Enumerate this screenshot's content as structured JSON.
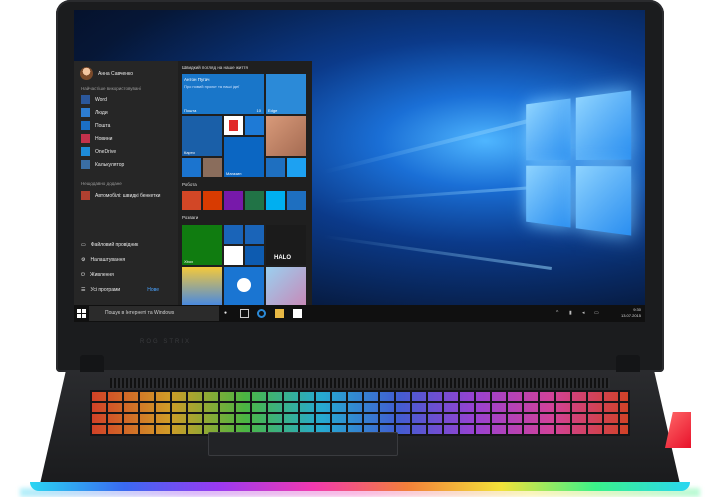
{
  "device": {
    "brand_text": "ROG STRIX"
  },
  "start_menu": {
    "user_name": "Анна Савченко",
    "most_used_header": "Найчастіше використовувані",
    "apps": [
      {
        "label": "Word",
        "color": "#2b579a"
      },
      {
        "label": "Люди",
        "color": "#2d7dd2"
      },
      {
        "label": "Пошта",
        "color": "#1b6fc4"
      },
      {
        "label": "Новини",
        "color": "#c4314b"
      },
      {
        "label": "OneDrive",
        "color": "#1e8bd8"
      },
      {
        "label": "Калькулятор",
        "color": "#3a6ea5"
      }
    ],
    "recently_added_header": "Нещодавно додане",
    "recent_item": "Автомобілі: швидкі бенкетки",
    "bottom_items": [
      {
        "label": "Файловий провідник",
        "icon": "folder-icon"
      },
      {
        "label": "Налаштування",
        "icon": "gear-icon"
      },
      {
        "label": "Живлення",
        "icon": "power-icon"
      },
      {
        "label": "Усі програми",
        "icon": "all-apps-icon",
        "badge": "Нове"
      }
    ],
    "life_header": "Швидкий погляд на наше життя",
    "work_header": "Робота",
    "play_header": "Розваги",
    "tiles": {
      "calendar_title": "Антон Пугач",
      "calendar_text": "Про новий проєкт та наші ідеї",
      "calendar_label": "Пошта",
      "calendar_count": "10",
      "tile_edge": "Edge",
      "maps_label": "Карти",
      "store_label": "Магазин",
      "xbox_label": "Xbox",
      "halo_label": "HALO"
    }
  },
  "taskbar": {
    "search_placeholder": "Пошук в Інтернеті та Windows",
    "time": "9:30",
    "date": "13.07.2015"
  }
}
